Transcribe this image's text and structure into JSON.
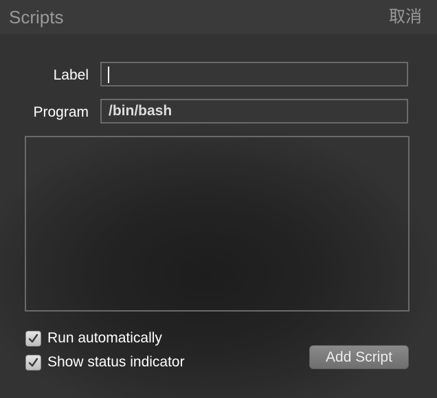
{
  "window": {
    "title": "Scripts",
    "cancel_label": "取消"
  },
  "form": {
    "label_text": "Label",
    "label_value": "",
    "program_text": "Program",
    "program_value": "/bin/bash",
    "script_value": ""
  },
  "options": {
    "run_automatically": {
      "label": "Run automatically",
      "checked": true
    },
    "show_status_indicator": {
      "label": "Show status indicator",
      "checked": true
    }
  },
  "actions": {
    "add_script_label": "Add Script"
  }
}
